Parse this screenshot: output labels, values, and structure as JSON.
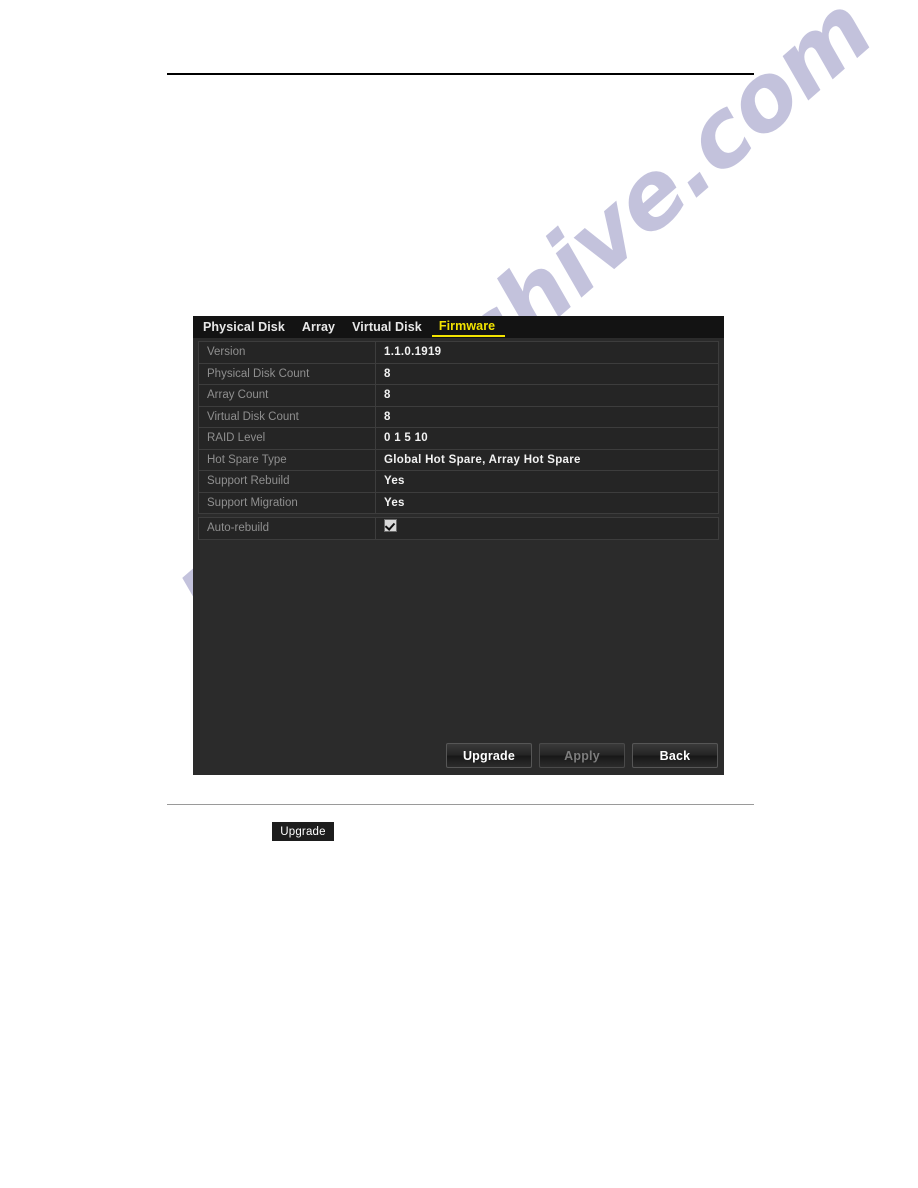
{
  "page": {
    "watermark": "manualshive.com",
    "inline_upgrade_label": "Upgrade"
  },
  "dialog": {
    "tabs": [
      {
        "label": "Physical Disk",
        "active": false
      },
      {
        "label": "Array",
        "active": false
      },
      {
        "label": "Virtual Disk",
        "active": false
      },
      {
        "label": "Firmware",
        "active": true
      }
    ],
    "rows": [
      {
        "key": "Version",
        "value": "1.1.0.1919"
      },
      {
        "key": "Physical Disk Count",
        "value": "8"
      },
      {
        "key": "Array Count",
        "value": "8"
      },
      {
        "key": "Virtual Disk Count",
        "value": "8"
      },
      {
        "key": "RAID Level",
        "value": "0  1  5  10"
      },
      {
        "key": "Hot Spare Type",
        "value": "Global Hot Spare, Array Hot Spare"
      },
      {
        "key": "Support Rebuild",
        "value": "Yes"
      },
      {
        "key": "Support Migration",
        "value": "Yes"
      }
    ],
    "auto_rebuild": {
      "key": "Auto-rebuild",
      "checked": true
    },
    "buttons": {
      "upgrade": "Upgrade",
      "apply": "Apply",
      "back": "Back"
    }
  },
  "colors": {
    "accent_tab": "#f2e300",
    "dialog_bg": "#2b2b2b",
    "tabbar_bg": "#131313",
    "row_bg": "#252525",
    "watermark": "#3b3a8f"
  }
}
